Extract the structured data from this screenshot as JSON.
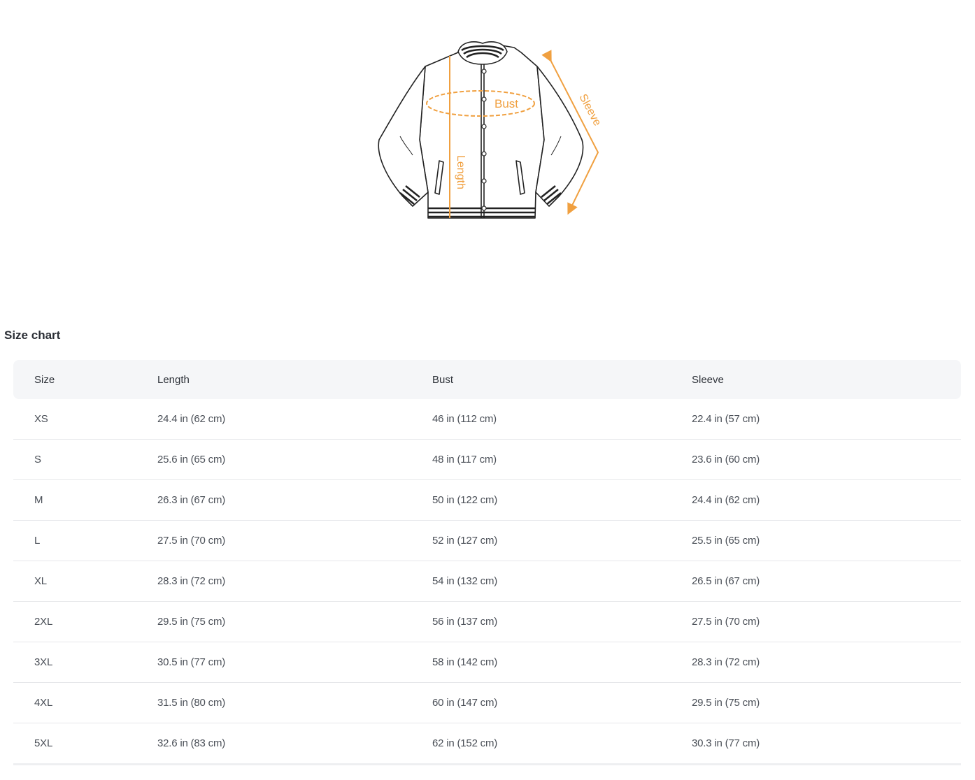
{
  "diagram": {
    "labels": {
      "bust": "Bust",
      "length": "Length",
      "sleeve": "Sleeve"
    },
    "accent_color": "#f0a040",
    "line_color": "#222222"
  },
  "section_title": "Size chart",
  "table": {
    "headers": [
      "Size",
      "Length",
      "Bust",
      "Sleeve"
    ],
    "rows": [
      [
        "XS",
        "24.4 in  (62 cm)",
        "46 in  (112 cm)",
        "22.4 in  (57 cm)"
      ],
      [
        "S",
        "25.6 in  (65 cm)",
        "48 in  (117 cm)",
        "23.6 in  (60 cm)"
      ],
      [
        "M",
        "26.3 in  (67 cm)",
        "50 in  (122 cm)",
        "24.4 in  (62 cm)"
      ],
      [
        "L",
        "27.5 in  (70 cm)",
        "52 in  (127 cm)",
        "25.5 in  (65 cm)"
      ],
      [
        "XL",
        "28.3 in  (72 cm)",
        "54 in  (132 cm)",
        "26.5 in  (67 cm)"
      ],
      [
        "2XL",
        "29.5 in  (75 cm)",
        "56 in  (137 cm)",
        "27.5 in  (70 cm)"
      ],
      [
        "3XL",
        "30.5 in  (77 cm)",
        "58 in  (142 cm)",
        "28.3 in  (72 cm)"
      ],
      [
        "4XL",
        "31.5 in  (80 cm)",
        "60 in  (147 cm)",
        "29.5 in  (75 cm)"
      ],
      [
        "5XL",
        "32.6 in  (83 cm)",
        "62 in  (152 cm)",
        "30.3 in  (77 cm)"
      ]
    ]
  }
}
